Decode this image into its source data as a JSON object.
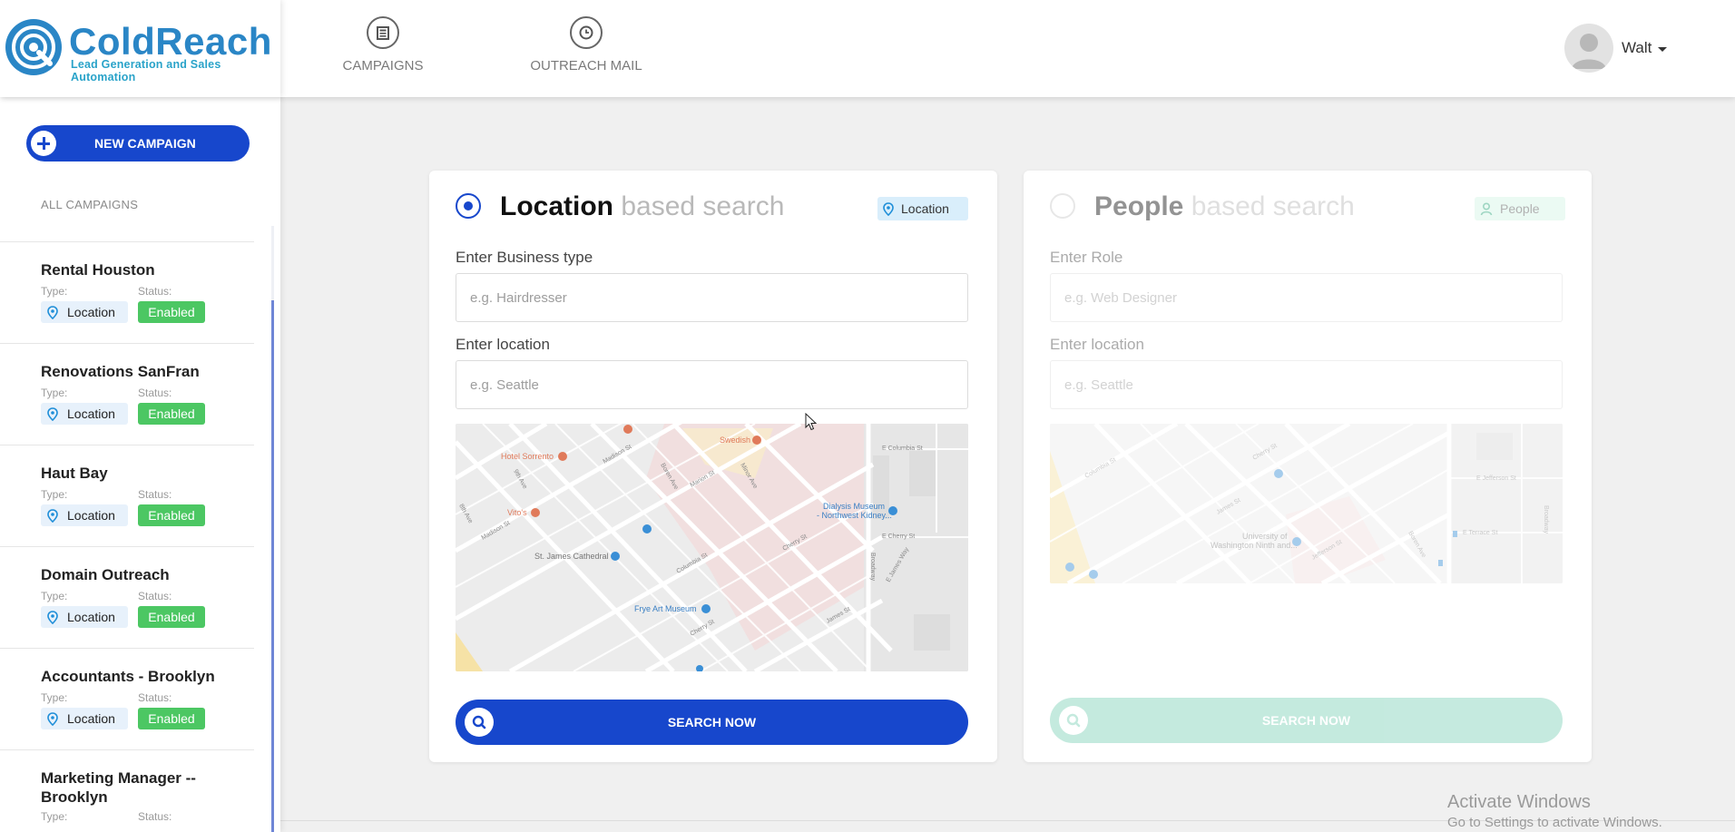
{
  "brand": {
    "name": "ColdReach",
    "tagline": "Lead Generation and Sales Automation"
  },
  "nav": {
    "items": [
      {
        "label": "CAMPAIGNS",
        "icon": "newspaper-icon"
      },
      {
        "label": "OUTREACH MAIL",
        "icon": "clock-icon"
      }
    ]
  },
  "user": {
    "name": "Walt",
    "icon": "user-avatar-icon"
  },
  "sidebar": {
    "new_campaign_label": "NEW CAMPAIGN",
    "section_title": "ALL CAMPAIGNS",
    "type_label": "Type:",
    "status_label": "Status:",
    "campaigns": [
      {
        "name": "Rental Houston",
        "type": "Location",
        "status": "Enabled"
      },
      {
        "name": "Renovations SanFran",
        "type": "Location",
        "status": "Enabled"
      },
      {
        "name": "Haut Bay",
        "type": "Location",
        "status": "Enabled"
      },
      {
        "name": "Domain Outreach",
        "type": "Location",
        "status": "Enabled"
      },
      {
        "name": "Accountants - Brooklyn",
        "type": "Location",
        "status": "Enabled"
      },
      {
        "name": "Marketing Manager -- Brooklyn",
        "type": "",
        "status": ""
      }
    ]
  },
  "location_search": {
    "title_bold": "Location",
    "title_rest": "based search",
    "tag": "Location",
    "business_label": "Enter Business type",
    "business_placeholder": "e.g. Hairdresser",
    "location_label": "Enter location",
    "location_placeholder": "e.g. Seattle",
    "button": "SEARCH NOW",
    "map_labels": {
      "hotel": "Hotel Sorrento",
      "swedish": "Swedish",
      "vitos": "Vito's",
      "dialysis_1": "Dialysis Museum",
      "dialysis_2": "- Northwest Kidney...",
      "cathedral": "St. James Cathedral",
      "frye": "Frye Art Museum",
      "madison1": "Madison St",
      "madison2": "Madison St",
      "boren": "Boren Ave",
      "marion": "Marion St",
      "minor": "Minor Ave",
      "columbia": "Columbia St",
      "columbia2": "E Columbia St",
      "cherry": "Cherry St",
      "cherry2": "E Cherry St",
      "james": "James St",
      "ejames": "E James Way",
      "broadway": "Broadway",
      "9th": "9th Ave",
      "8th": "8th Ave"
    }
  },
  "people_search": {
    "title_bold": "People",
    "title_rest": "based search",
    "tag": "People",
    "role_label": "Enter Role",
    "role_placeholder": "e.g. Web Designer",
    "location_label": "Enter location",
    "location_placeholder": "e.g. Seattle",
    "button": "SEARCH NOW",
    "map_labels": {
      "university": "University of",
      "university2": "Washington Ninth and...",
      "columbia": "Columbia St",
      "cherry": "Cherry St",
      "james": "James St",
      "jefferson": "Jefferson St",
      "ejefferson": "E Jefferson St",
      "eterrace": "E Terrace St",
      "boren": "Boren Ave",
      "broadway": "Broadway"
    }
  },
  "watermark": {
    "line1": "Activate Windows",
    "line2": "Go to Settings to activate Windows."
  },
  "colors": {
    "primary": "#1747cc",
    "success": "#4cc763",
    "brand": "#2a86c6",
    "people_button": "#7ed1b7"
  }
}
